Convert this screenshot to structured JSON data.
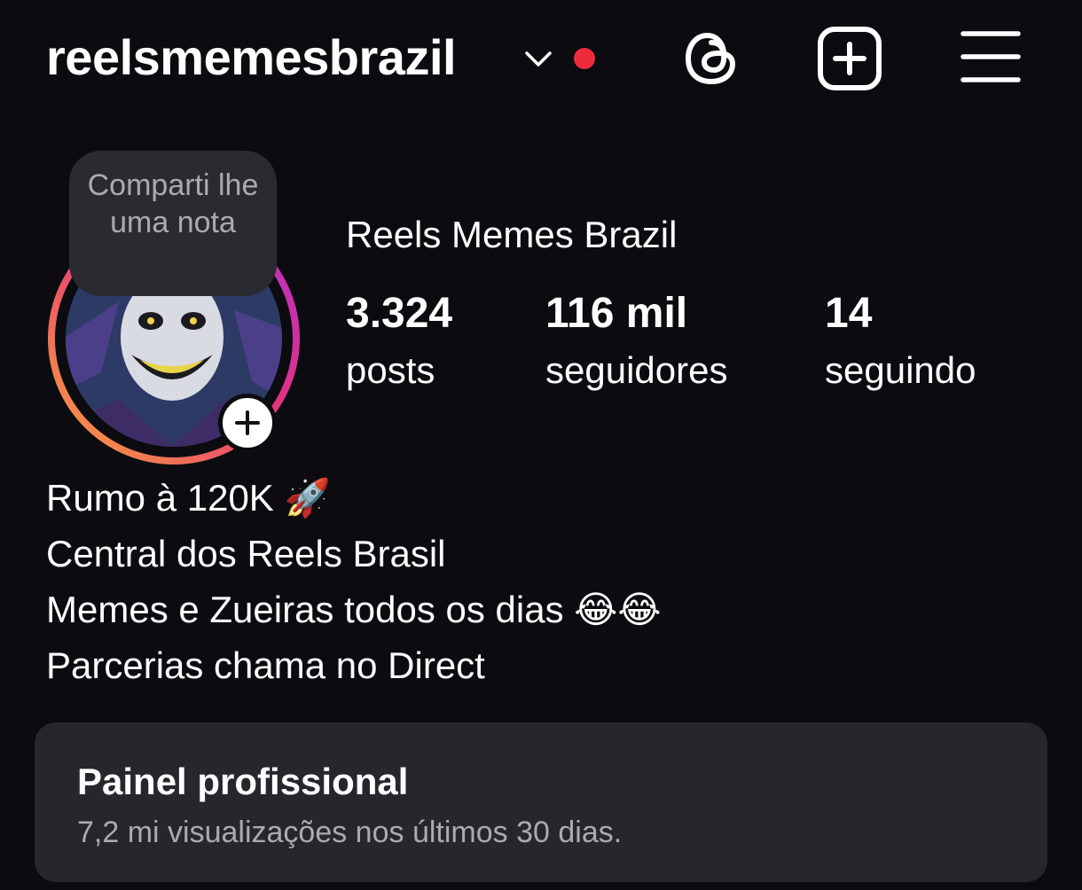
{
  "header": {
    "username": "reelsmemesbrazil",
    "chevron_icon": "chevron-down-icon",
    "notification_dot_color": "#ee2b3b",
    "threads_icon": "threads-icon",
    "create_icon": "plus-square-icon",
    "menu_icon": "hamburger-menu-icon"
  },
  "note": {
    "text": "Comparti lhe uma nota"
  },
  "profile": {
    "display_name": "Reels Memes Brazil",
    "avatar_icon": "joker-avatar",
    "add_story_icon": "plus-icon",
    "stats": {
      "posts": {
        "value": "3.324",
        "label": "posts"
      },
      "followers": {
        "value": "116 mil",
        "label": "seguidores"
      },
      "following": {
        "value": "14",
        "label": "seguindo"
      }
    }
  },
  "bio": {
    "lines": [
      "Rumo à 120K 🚀",
      "Central dos Reels Brasil",
      "Memes e Zueiras todos os dias 😂😂",
      "Parcerias chama no Direct"
    ]
  },
  "dashboard": {
    "title": "Painel profissional",
    "subtitle": "7,2 mi visualizações nos últimos 30 dias."
  },
  "colors": {
    "background": "#0c0c10",
    "card": "#26272c",
    "muted_text": "#a9abb2",
    "ring_start": "#f9a43b",
    "ring_mid": "#e6347a",
    "ring_end": "#b02fd0"
  }
}
